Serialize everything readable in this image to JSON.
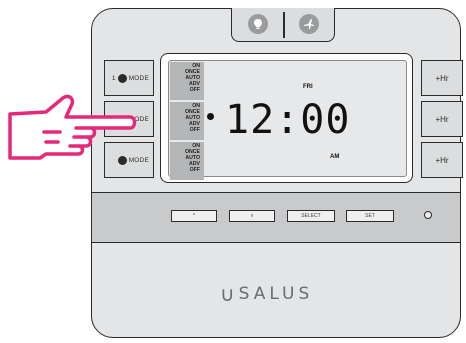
{
  "modes": {
    "m1": {
      "prefix": "1",
      "label": "MODE"
    },
    "m2": {
      "label": "ODE"
    },
    "m3": {
      "label": "MODE"
    }
  },
  "mode_list": [
    "ON",
    "ONCE",
    "AUTO",
    "ADV",
    "OFF"
  ],
  "lcd": {
    "day": "FRI",
    "time": "12:00",
    "ampm": "AM"
  },
  "hour_buttons": [
    "+Hr",
    "+Hr",
    "+Hr"
  ],
  "controls": {
    "up": "^",
    "down": "v",
    "select": "SELECT",
    "set": "SET"
  },
  "brand": "SALUS",
  "colors": {
    "hand": "#e6287a",
    "outline": "#2b2b2b",
    "body": "#e4e5e6"
  }
}
